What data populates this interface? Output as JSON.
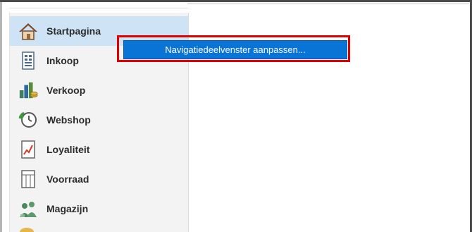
{
  "sidebar": {
    "items": [
      {
        "label": "Startpagina",
        "icon": "home-icon"
      },
      {
        "label": "Inkoop",
        "icon": "purchase-icon"
      },
      {
        "label": "Verkoop",
        "icon": "sales-icon"
      },
      {
        "label": "Webshop",
        "icon": "webshop-icon"
      },
      {
        "label": "Loyaliteit",
        "icon": "loyalty-icon"
      },
      {
        "label": "Voorraad",
        "icon": "inventory-icon"
      },
      {
        "label": "Magazijn",
        "icon": "warehouse-icon"
      },
      {
        "label": "",
        "icon": "partial-icon"
      }
    ],
    "selected": "Startpagina"
  },
  "context_menu": {
    "item_label": "Navigatiedeelvenster aanpassen..."
  },
  "colors": {
    "selected_bg": "#cfe3f7",
    "menu_bg": "#0a74d6",
    "highlight_border": "#e00000"
  }
}
